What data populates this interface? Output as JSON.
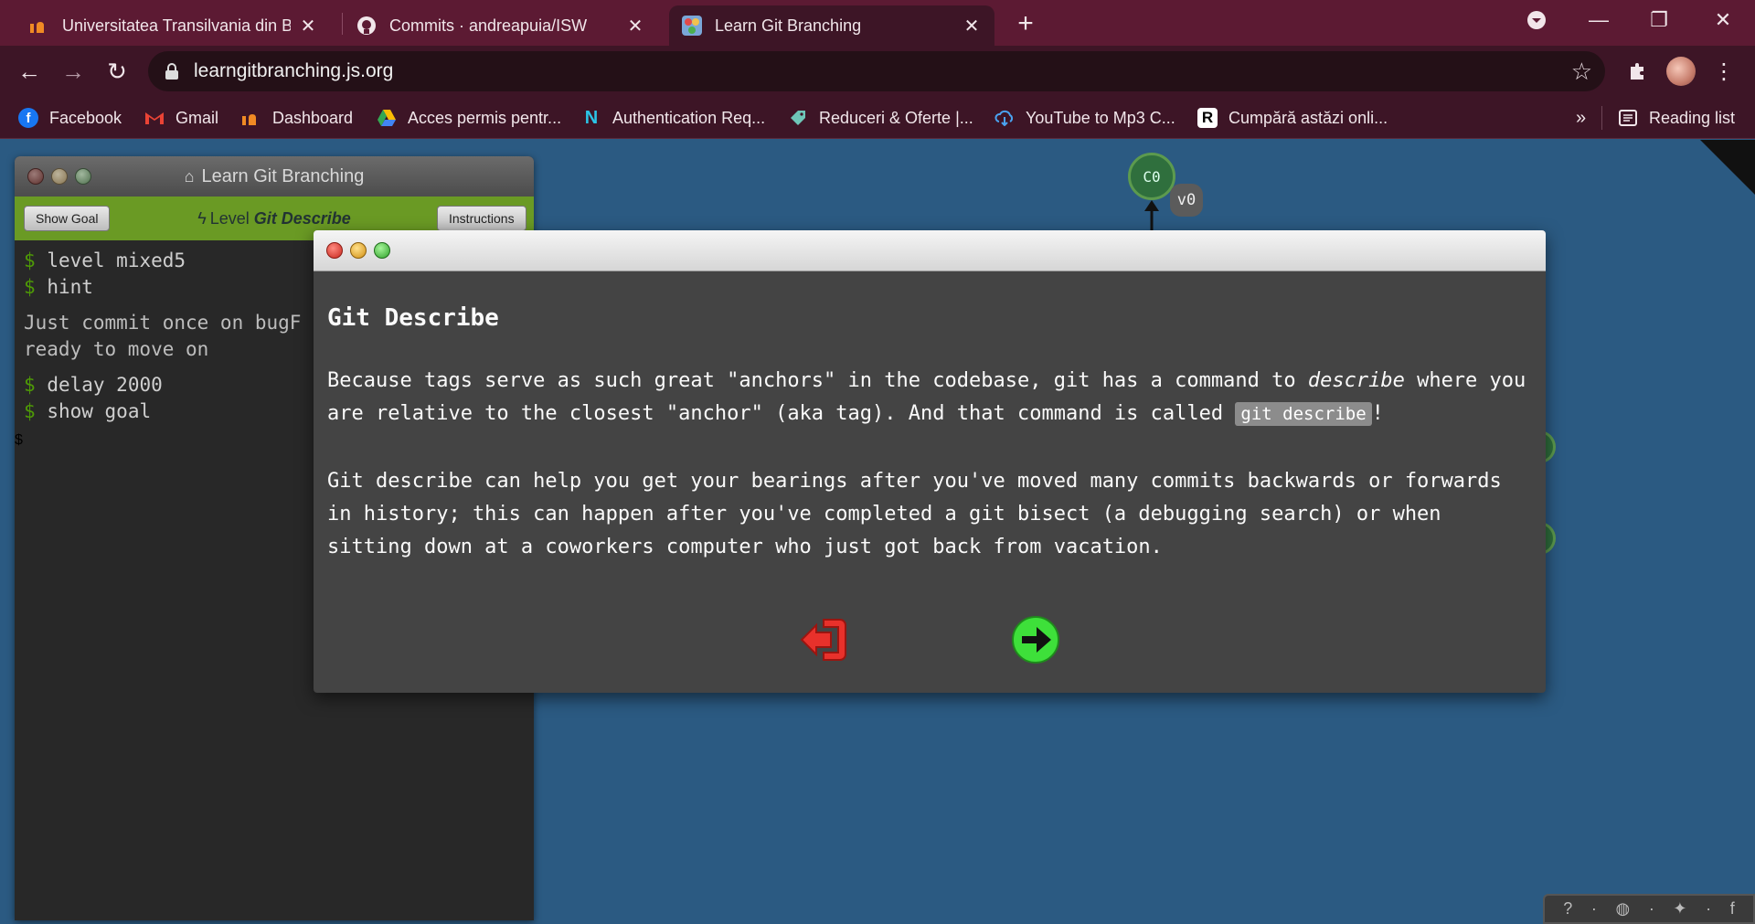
{
  "browser": {
    "tabs": [
      {
        "title": "Universitatea Transilvania din Bra",
        "active": false
      },
      {
        "title": "Commits · andreapuia/ISW",
        "active": false
      },
      {
        "title": "Learn Git Branching",
        "active": true
      }
    ],
    "url": "learngitbranching.js.org",
    "bookmarks": [
      {
        "label": "Facebook",
        "icon": "facebook-icon"
      },
      {
        "label": "Gmail",
        "icon": "gmail-icon"
      },
      {
        "label": "Dashboard",
        "icon": "unitbv-icon"
      },
      {
        "label": "Acces permis pentr...",
        "icon": "drive-icon"
      },
      {
        "label": "Authentication Req...",
        "icon": "n-icon"
      },
      {
        "label": "Reduceri & Oferte |...",
        "icon": "tag-icon"
      },
      {
        "label": "YouTube to Mp3 C...",
        "icon": "download-cloud-icon"
      },
      {
        "label": "Cumpără astăzi onli...",
        "icon": "r-icon"
      }
    ],
    "more_bookmarks": "»",
    "reading_list": "Reading list"
  },
  "app": {
    "window_title": "Learn Git Branching",
    "show_goal": "Show Goal",
    "level_prefix": "Level ",
    "level_name": "Git Describe",
    "instructions": "Instructions",
    "terminal": {
      "lines": [
        {
          "type": "cmd",
          "text": "level mixed5"
        },
        {
          "type": "cmd",
          "text": "hint"
        },
        {
          "type": "out",
          "text": "Just commit once on bugF"
        },
        {
          "type": "out",
          "text": "ready to move on"
        },
        {
          "type": "cmd",
          "text": "delay 2000"
        },
        {
          "type": "cmd",
          "text": "show goal"
        }
      ],
      "prompt": "$"
    },
    "tree": {
      "commit": "C0",
      "tag": "v0"
    }
  },
  "modal": {
    "title": "Git Describe",
    "p1_a": "Because tags serve as such great \"anchors\" in the codebase, git has a command to ",
    "p1_em": "describe",
    "p1_b": " where you are relative to the closest \"anchor\" (aka tag). And that command is called ",
    "p1_code": "git describe",
    "p1_c": "!",
    "p2": "Git describe can help you get your bearings after you've moved many commits backwards or forwards in history; this can happen after you've completed a git bisect (a debugging search) or when sitting down at a coworkers computer who just got back from vacation.",
    "colors": {
      "exit": "#e8312b",
      "next": "#3ee03a"
    }
  },
  "footer_icons": [
    "help-icon",
    "globe-icon",
    "twitter-icon",
    "facebook-icon"
  ]
}
